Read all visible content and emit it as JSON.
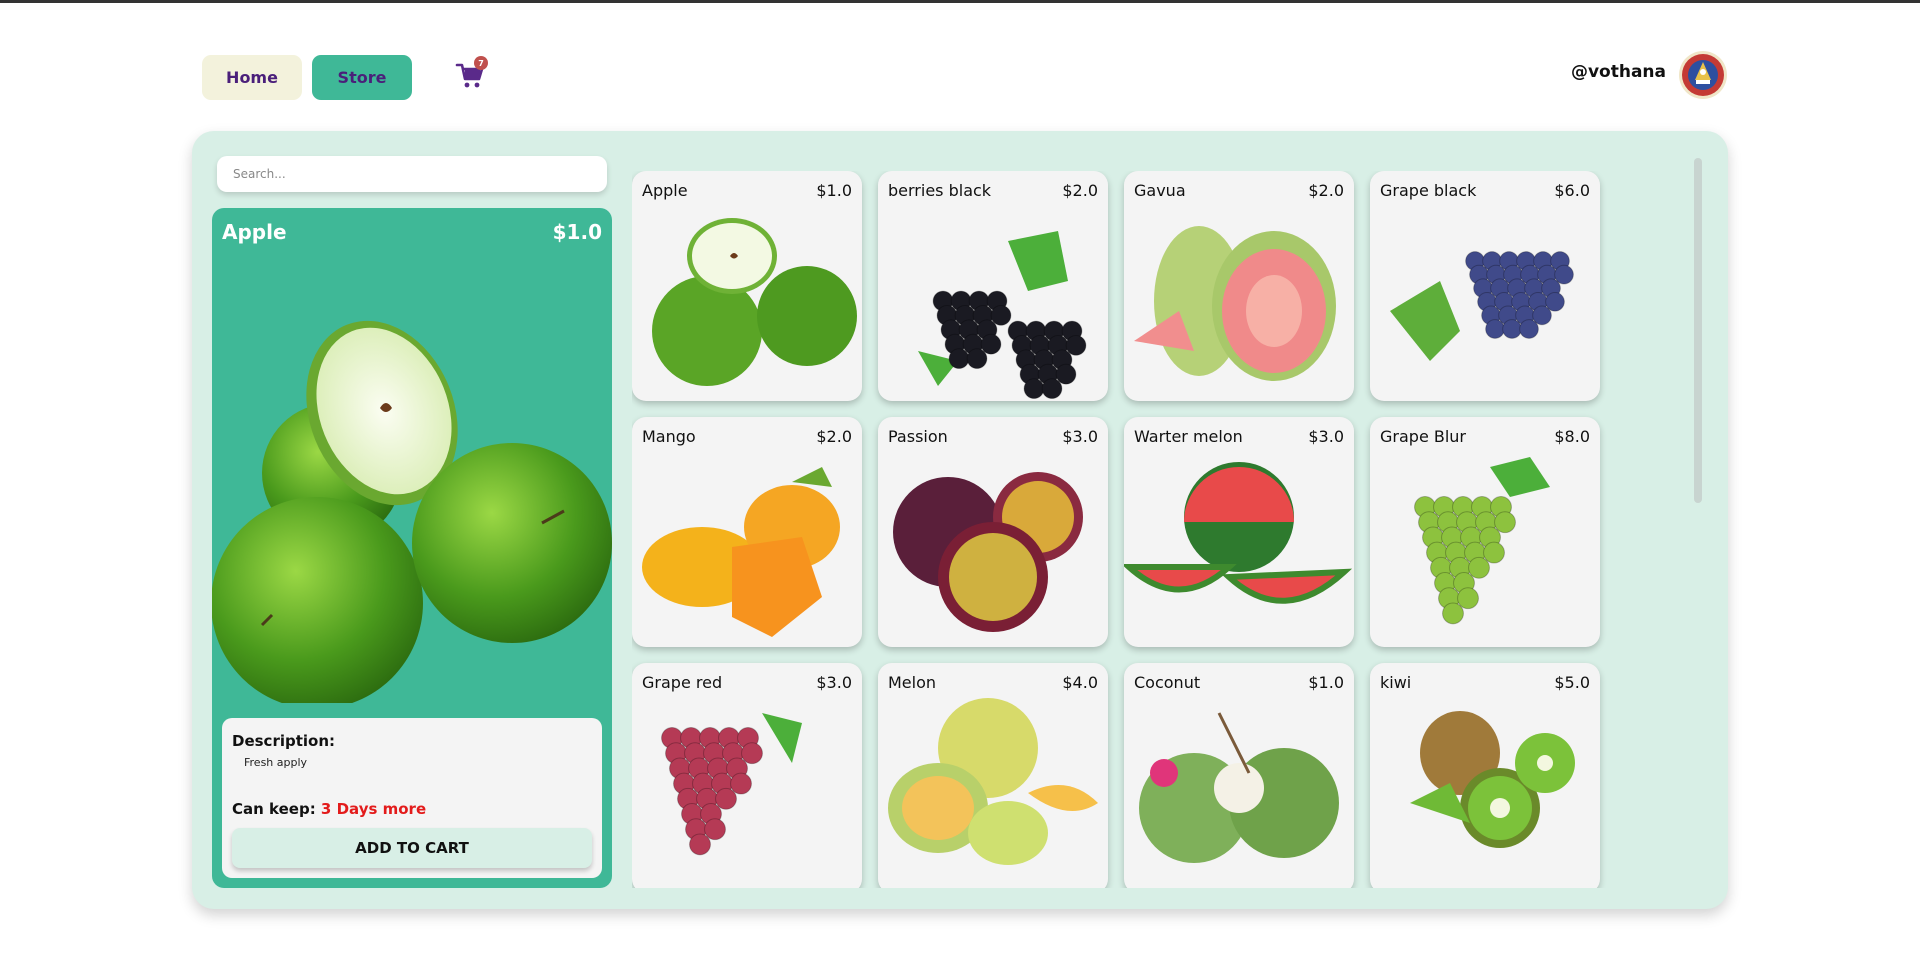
{
  "header": {
    "home_label": "Home",
    "store_label": "Store",
    "cart_icon": "cart-icon",
    "cart_count": "7",
    "username": "@vothana",
    "avatar_icon": "seal-emblem"
  },
  "search": {
    "placeholder": "Search..."
  },
  "detail": {
    "name": "Apple",
    "price": "$1.0",
    "description_label": "Description:",
    "description": "Fresh apply",
    "can_keep_label": "Can keep:",
    "can_keep_value": "3 Days more",
    "add_to_cart_label": "ADD TO CART"
  },
  "products": [
    {
      "name": "Apple",
      "price": "$1.0",
      "fruit": "apple"
    },
    {
      "name": "berries black",
      "price": "$2.0",
      "fruit": "blackberry"
    },
    {
      "name": "Gavua",
      "price": "$2.0",
      "fruit": "guava"
    },
    {
      "name": "Grape black",
      "price": "$6.0",
      "fruit": "grape-black"
    },
    {
      "name": "Mango",
      "price": "$2.0",
      "fruit": "mango"
    },
    {
      "name": "Passion",
      "price": "$3.0",
      "fruit": "passion"
    },
    {
      "name": "Warter melon",
      "price": "$3.0",
      "fruit": "watermelon"
    },
    {
      "name": "Grape Blur",
      "price": "$8.0",
      "fruit": "grape-green"
    },
    {
      "name": "Grape red",
      "price": "$3.0",
      "fruit": "grape-red"
    },
    {
      "name": "Melon",
      "price": "$4.0",
      "fruit": "melon"
    },
    {
      "name": "Coconut",
      "price": "$1.0",
      "fruit": "coconut"
    },
    {
      "name": "kiwi",
      "price": "$5.0",
      "fruit": "kiwi"
    }
  ],
  "colors": {
    "accent": "#3fb897",
    "panel": "#d8efe6",
    "home_button": "#f3f2dc",
    "nav_text": "#4a1f7a",
    "warning": "#e31b1b"
  }
}
